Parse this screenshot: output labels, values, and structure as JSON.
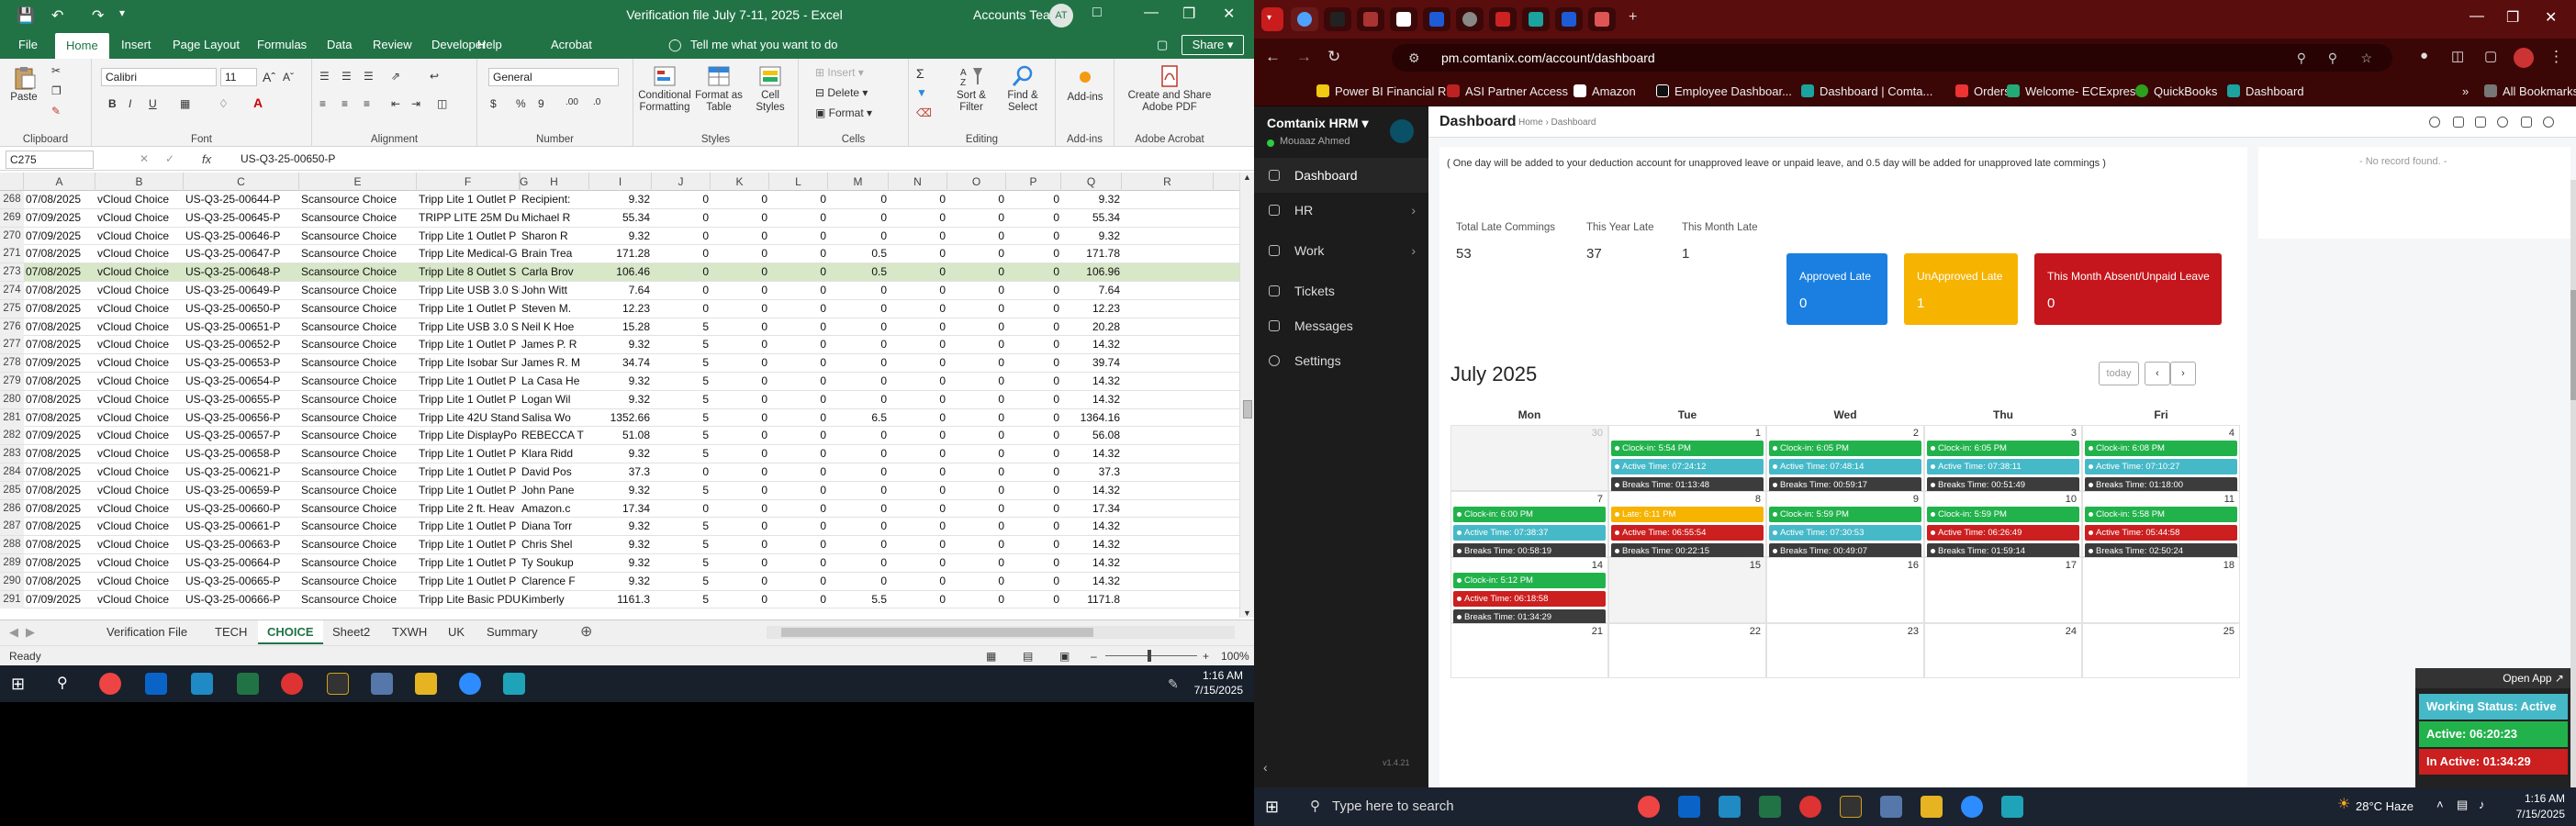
{
  "excel": {
    "title": "Verification file July 7-11, 2025  -  Excel",
    "account": "Accounts Team",
    "avatar": "AT",
    "tabs": [
      "File",
      "Home",
      "Insert",
      "Page Layout",
      "Formulas",
      "Data",
      "Review",
      "Developer",
      "Help",
      "Acrobat"
    ],
    "tellme": "Tell me what you want to do",
    "share": "Share",
    "ribbon": {
      "paste": "Paste",
      "clipboard": "Clipboard",
      "font_name": "Calibri",
      "font_size": "11",
      "font": "Font",
      "alignment": "Alignment",
      "number_format": "General",
      "number": "Number",
      "conditional_formatting": "Conditional Formatting",
      "format_as_table": "Format as Table",
      "cell_styles": "Cell Styles",
      "styles": "Styles",
      "insert": "Insert",
      "delete": "Delete",
      "format": "Format",
      "cells": "Cells",
      "sort_filter": "Sort & Filter",
      "find_select": "Find & Select",
      "editing": "Editing",
      "addins": "Add-ins",
      "addins_group": "Add-ins",
      "create_pdf": "Create and Share Adobe PDF",
      "adobe": "Adobe Acrobat"
    },
    "name_box": "C275",
    "formula": "US-Q3-25-00650-P",
    "columns": [
      "A",
      "B",
      "C",
      "E",
      "F",
      "G",
      "H",
      "I",
      "J",
      "K",
      "L",
      "M",
      "N",
      "O",
      "P",
      "Q",
      "R"
    ],
    "rows": [
      {
        "n": "268",
        "a": "07/08/2025",
        "b": "vCloud Choice",
        "c": "US-Q3-25-00644-P",
        "e": "Scansource Choice",
        "f": "Tripp Lite 1 Outlet P",
        "h": "Recipient:",
        "i": "9.32",
        "j": "0",
        "k": "0",
        "l": "0",
        "m": "0",
        "n2": "0",
        "o": "0",
        "p": "0",
        "q": "9.32"
      },
      {
        "n": "269",
        "a": "07/09/2025",
        "b": "vCloud Choice",
        "c": "US-Q3-25-00645-P",
        "e": "Scansource Choice",
        "f": "TRIPP LITE 25M Dupl",
        "h": "Michael R",
        "i": "55.34",
        "j": "0",
        "k": "0",
        "l": "0",
        "m": "0",
        "n2": "0",
        "o": "0",
        "p": "0",
        "q": "55.34"
      },
      {
        "n": "270",
        "a": "07/09/2025",
        "b": "vCloud Choice",
        "c": "US-Q3-25-00646-P",
        "e": "Scansource Choice",
        "f": "Tripp Lite 1 Outlet P",
        "h": "Sharon R",
        "i": "9.32",
        "j": "0",
        "k": "0",
        "l": "0",
        "m": "0",
        "n2": "0",
        "o": "0",
        "p": "0",
        "q": "9.32"
      },
      {
        "n": "271",
        "a": "07/08/2025",
        "b": "vCloud Choice",
        "c": "US-Q3-25-00647-P",
        "e": "Scansource Choice",
        "f": "Tripp Lite Medical-G",
        "h": "Brain Trea",
        "i": "171.28",
        "j": "0",
        "k": "0",
        "l": "0",
        "m": "0.5",
        "n2": "0",
        "o": "0",
        "p": "0",
        "q": "171.78"
      },
      {
        "n": "273",
        "a": "07/08/2025",
        "b": "vCloud Choice",
        "c": "US-Q3-25-00648-P",
        "e": "Scansource Choice",
        "f": "Tripp Lite 8 Outlet S",
        "h": "Carla Brov",
        "i": "106.46",
        "j": "0",
        "k": "0",
        "l": "0",
        "m": "0.5",
        "n2": "0",
        "o": "0",
        "p": "0",
        "q": "106.96",
        "sel": true
      },
      {
        "n": "274",
        "a": "07/08/2025",
        "b": "vCloud Choice",
        "c": "US-Q3-25-00649-P",
        "e": "Scansource Choice",
        "f": "Tripp Lite USB 3.0 Su",
        "h": "John Witt",
        "i": "7.64",
        "j": "0",
        "k": "0",
        "l": "0",
        "m": "0",
        "n2": "0",
        "o": "0",
        "p": "0",
        "q": "7.64"
      },
      {
        "n": "275",
        "a": "07/08/2025",
        "b": "vCloud Choice",
        "c": "US-Q3-25-00650-P",
        "e": "Scansource Choice",
        "f": "Tripp Lite 1 Outlet P",
        "h": "Steven M.",
        "i": "12.23",
        "j": "0",
        "k": "0",
        "l": "0",
        "m": "0",
        "n2": "0",
        "o": "0",
        "p": "0",
        "q": "12.23"
      },
      {
        "n": "276",
        "a": "07/08/2025",
        "b": "vCloud Choice",
        "c": "US-Q3-25-00651-P",
        "e": "Scansource Choice",
        "f": "Tripp Lite USB 3.0 S.",
        "h": "Neil K Hoe",
        "i": "15.28",
        "j": "5",
        "k": "0",
        "l": "0",
        "m": "0",
        "n2": "0",
        "o": "0",
        "p": "0",
        "q": "20.28"
      },
      {
        "n": "277",
        "a": "07/08/2025",
        "b": "vCloud Choice",
        "c": "US-Q3-25-00652-P",
        "e": "Scansource Choice",
        "f": "Tripp Lite 1 Outlet P",
        "h": "James P. R",
        "i": "9.32",
        "j": "5",
        "k": "0",
        "l": "0",
        "m": "0",
        "n2": "0",
        "o": "0",
        "p": "0",
        "q": "14.32"
      },
      {
        "n": "278",
        "a": "07/09/2025",
        "b": "vCloud Choice",
        "c": "US-Q3-25-00653-P",
        "e": "Scansource Choice",
        "f": "Tripp Lite Isobar Sur",
        "h": "James R. M",
        "i": "34.74",
        "j": "5",
        "k": "0",
        "l": "0",
        "m": "0",
        "n2": "0",
        "o": "0",
        "p": "0",
        "q": "39.74"
      },
      {
        "n": "279",
        "a": "07/08/2025",
        "b": "vCloud Choice",
        "c": "US-Q3-25-00654-P",
        "e": "Scansource Choice",
        "f": "Tripp Lite 1 Outlet P",
        "h": "La Casa He",
        "i": "9.32",
        "j": "5",
        "k": "0",
        "l": "0",
        "m": "0",
        "n2": "0",
        "o": "0",
        "p": "0",
        "q": "14.32"
      },
      {
        "n": "280",
        "a": "07/08/2025",
        "b": "vCloud Choice",
        "c": "US-Q3-25-00655-P",
        "e": "Scansource Choice",
        "f": "Tripp Lite 1 Outlet P",
        "h": "Logan Wil",
        "i": "9.32",
        "j": "5",
        "k": "0",
        "l": "0",
        "m": "0",
        "n2": "0",
        "o": "0",
        "p": "0",
        "q": "14.32"
      },
      {
        "n": "281",
        "a": "07/08/2025",
        "b": "vCloud Choice",
        "c": "US-Q3-25-00656-P",
        "e": "Scansource Choice",
        "f": "Tripp Lite 42U Stand",
        "h": "Salisa Wo",
        "i": "1352.66",
        "j": "5",
        "k": "0",
        "l": "0",
        "m": "6.5",
        "n2": "0",
        "o": "0",
        "p": "0",
        "q": "1364.16"
      },
      {
        "n": "282",
        "a": "07/09/2025",
        "b": "vCloud Choice",
        "c": "US-Q3-25-00657-P",
        "e": "Scansource Choice",
        "f": "Tripp Lite DisplayPo",
        "h": "REBECCA T",
        "i": "51.08",
        "j": "5",
        "k": "0",
        "l": "0",
        "m": "0",
        "n2": "0",
        "o": "0",
        "p": "0",
        "q": "56.08"
      },
      {
        "n": "283",
        "a": "07/08/2025",
        "b": "vCloud Choice",
        "c": "US-Q3-25-00658-P",
        "e": "Scansource Choice",
        "f": "Tripp Lite 1 Outlet P",
        "h": "Klara Ridd",
        "i": "9.32",
        "j": "5",
        "k": "0",
        "l": "0",
        "m": "0",
        "n2": "0",
        "o": "0",
        "p": "0",
        "q": "14.32"
      },
      {
        "n": "284",
        "a": "07/08/2025",
        "b": "vCloud Choice",
        "c": "US-Q3-25-00621-P",
        "e": "Scansource Choice",
        "f": "Tripp Lite 1 Outlet P",
        "h": "David Pos",
        "i": "37.3",
        "j": "0",
        "k": "0",
        "l": "0",
        "m": "0",
        "n2": "0",
        "o": "0",
        "p": "0",
        "q": "37.3"
      },
      {
        "n": "285",
        "a": "07/08/2025",
        "b": "vCloud Choice",
        "c": "US-Q3-25-00659-P",
        "e": "Scansource Choice",
        "f": "Tripp Lite 1 Outlet P",
        "h": "John Pane",
        "i": "9.32",
        "j": "5",
        "k": "0",
        "l": "0",
        "m": "0",
        "n2": "0",
        "o": "0",
        "p": "0",
        "q": "14.32"
      },
      {
        "n": "286",
        "a": "07/08/2025",
        "b": "vCloud Choice",
        "c": "US-Q3-25-00660-P",
        "e": "Scansource Choice",
        "f": "Tripp Lite 2 ft. Heav",
        "h": "Amazon.c",
        "i": "17.34",
        "j": "0",
        "k": "0",
        "l": "0",
        "m": "0",
        "n2": "0",
        "o": "0",
        "p": "0",
        "q": "17.34"
      },
      {
        "n": "287",
        "a": "07/08/2025",
        "b": "vCloud Choice",
        "c": "US-Q3-25-00661-P",
        "e": "Scansource Choice",
        "f": "Tripp Lite 1 Outlet P",
        "h": "Diana Torr",
        "i": "9.32",
        "j": "5",
        "k": "0",
        "l": "0",
        "m": "0",
        "n2": "0",
        "o": "0",
        "p": "0",
        "q": "14.32"
      },
      {
        "n": "288",
        "a": "07/08/2025",
        "b": "vCloud Choice",
        "c": "US-Q3-25-00663-P",
        "e": "Scansource Choice",
        "f": "Tripp Lite 1 Outlet P",
        "h": "Chris Shel",
        "i": "9.32",
        "j": "5",
        "k": "0",
        "l": "0",
        "m": "0",
        "n2": "0",
        "o": "0",
        "p": "0",
        "q": "14.32"
      },
      {
        "n": "289",
        "a": "07/08/2025",
        "b": "vCloud Choice",
        "c": "US-Q3-25-00664-P",
        "e": "Scansource Choice",
        "f": "Tripp Lite 1 Outlet P",
        "h": "Ty Soukup",
        "i": "9.32",
        "j": "5",
        "k": "0",
        "l": "0",
        "m": "0",
        "n2": "0",
        "o": "0",
        "p": "0",
        "q": "14.32"
      },
      {
        "n": "290",
        "a": "07/08/2025",
        "b": "vCloud Choice",
        "c": "US-Q3-25-00665-P",
        "e": "Scansource Choice",
        "f": "Tripp Lite 1 Outlet P",
        "h": "Clarence F",
        "i": "9.32",
        "j": "5",
        "k": "0",
        "l": "0",
        "m": "0",
        "n2": "0",
        "o": "0",
        "p": "0",
        "q": "14.32"
      },
      {
        "n": "291",
        "a": "07/09/2025",
        "b": "vCloud Choice",
        "c": "US-Q3-25-00666-P",
        "e": "Scansource Choice",
        "f": "Tripp Lite Basic PDU",
        "h": "Kimberly",
        "i": "1161.3",
        "j": "5",
        "k": "0",
        "l": "0",
        "m": "5.5",
        "n2": "0",
        "o": "0",
        "p": "0",
        "q": "1171.8"
      }
    ],
    "sheets": [
      "Verification File",
      "TECH",
      "CHOICE",
      "Sheet2",
      "TXWH",
      "UK",
      "Summary"
    ],
    "active_sheet": "CHOICE",
    "status": "Ready",
    "zoom": "100%"
  },
  "taskbar_left": {
    "time": "1:16 AM",
    "date": "7/15/2025"
  },
  "chrome": {
    "url": "pm.comtanix.com/account/dashboard",
    "bookmarks": [
      "Power BI Financial R...",
      "ASI Partner Access",
      "Amazon",
      "Employee Dashboar...",
      "Dashboard | Comta...",
      "Orders",
      "Welcome- ECExpres...",
      "QuickBooks",
      "Dashboard"
    ],
    "all_bookmarks": "All Bookmarks"
  },
  "hrm": {
    "brand": "Comtanix HRM",
    "user": "Mouaaz Ahmed",
    "nav": [
      "Dashboard",
      "HR",
      "Work",
      "Tickets",
      "Messages",
      "Settings"
    ],
    "version": "v1.4.21",
    "page_title": "Dashboard",
    "breadcrumb": "Home › Dashboard",
    "note": "( One day will be added to your deduction account for unapproved leave or unpaid leave, and 0.5 day will be added for unapproved late commings )",
    "no_record": "- No record found. -",
    "stats": [
      {
        "label": "Total Late Commings",
        "value": "53"
      },
      {
        "label": "This Year Late",
        "value": "37"
      },
      {
        "label": "This Month Late",
        "value": "1"
      }
    ],
    "boxes": [
      {
        "label": "Approved Late",
        "value": "0",
        "color": "#1a7fe0"
      },
      {
        "label": "UnApproved Late",
        "value": "1",
        "color": "#f6b300"
      },
      {
        "label": "This Month Absent/Unpaid Leave",
        "value": "0",
        "color": "#c4161c"
      }
    ],
    "month": "July 2025",
    "today": "today",
    "days": [
      "Mon",
      "Tue",
      "Wed",
      "Thu",
      "Fri"
    ],
    "weeks": [
      [
        {
          "d": "30",
          "out": true,
          "ev": []
        },
        {
          "d": "1",
          "ev": [
            {
              "c": "green",
              "t": "Clock-in: 5:54 PM"
            },
            {
              "c": "blue",
              "t": "Active Time: 07:24:12"
            },
            {
              "c": "dark",
              "t": "Breaks Time: 01:13:48"
            }
          ]
        },
        {
          "d": "2",
          "ev": [
            {
              "c": "green",
              "t": "Clock-in: 6:05 PM"
            },
            {
              "c": "blue",
              "t": "Active Time: 07:48:14"
            },
            {
              "c": "dark",
              "t": "Breaks Time: 00:59:17"
            }
          ]
        },
        {
          "d": "3",
          "ev": [
            {
              "c": "green",
              "t": "Clock-in: 6:05 PM"
            },
            {
              "c": "blue",
              "t": "Active Time: 07:38:11"
            },
            {
              "c": "dark",
              "t": "Breaks Time: 00:51:49"
            }
          ]
        },
        {
          "d": "4",
          "ev": [
            {
              "c": "green",
              "t": "Clock-in: 6:08 PM"
            },
            {
              "c": "blue",
              "t": "Active Time: 07:10:27"
            },
            {
              "c": "dark",
              "t": "Breaks Time: 01:18:00"
            }
          ]
        }
      ],
      [
        {
          "d": "7",
          "ev": [
            {
              "c": "green",
              "t": "Clock-in: 6:00 PM"
            },
            {
              "c": "blue",
              "t": "Active Time: 07:38:37"
            },
            {
              "c": "dark",
              "t": "Breaks Time: 00:58:19"
            }
          ]
        },
        {
          "d": "8",
          "ev": [
            {
              "c": "orange",
              "t": "Late: 6:11 PM"
            },
            {
              "c": "red",
              "t": "Active Time: 06:55:54"
            },
            {
              "c": "dark",
              "t": "Breaks Time: 00:22:15"
            }
          ]
        },
        {
          "d": "9",
          "ev": [
            {
              "c": "green",
              "t": "Clock-in: 5:59 PM"
            },
            {
              "c": "blue",
              "t": "Active Time: 07:30:53"
            },
            {
              "c": "dark",
              "t": "Breaks Time: 00:49:07"
            }
          ]
        },
        {
          "d": "10",
          "ev": [
            {
              "c": "green",
              "t": "Clock-in: 5:59 PM"
            },
            {
              "c": "red",
              "t": "Active Time: 06:26:49"
            },
            {
              "c": "dark",
              "t": "Breaks Time: 01:59:14"
            }
          ]
        },
        {
          "d": "11",
          "ev": [
            {
              "c": "green",
              "t": "Clock-in: 5:58 PM"
            },
            {
              "c": "red",
              "t": "Active Time: 05:44:58"
            },
            {
              "c": "dark",
              "t": "Breaks Time: 02:50:24"
            }
          ]
        }
      ],
      [
        {
          "d": "14",
          "ev": [
            {
              "c": "green",
              "t": "Clock-in: 5:12 PM"
            },
            {
              "c": "red",
              "t": "Active Time: 06:18:58"
            },
            {
              "c": "dark",
              "t": "Breaks Time: 01:34:29"
            }
          ]
        },
        {
          "d": "15",
          "out": true,
          "ev": []
        },
        {
          "d": "16",
          "ev": []
        },
        {
          "d": "17",
          "ev": []
        },
        {
          "d": "18",
          "ev": []
        }
      ],
      [
        {
          "d": "21",
          "ev": []
        },
        {
          "d": "22",
          "ev": []
        },
        {
          "d": "23",
          "ev": []
        },
        {
          "d": "24",
          "ev": []
        },
        {
          "d": "25",
          "ev": []
        }
      ]
    ],
    "open_app": "Open App ↗",
    "working_status": "Working Status: Active",
    "active": "Active: 06:20:23",
    "inactive": "In Active: 01:34:29"
  },
  "taskbar_right": {
    "search": "Type here to search",
    "weather": "28°C  Haze",
    "time": "1:16 AM",
    "date": "7/15/2025"
  }
}
